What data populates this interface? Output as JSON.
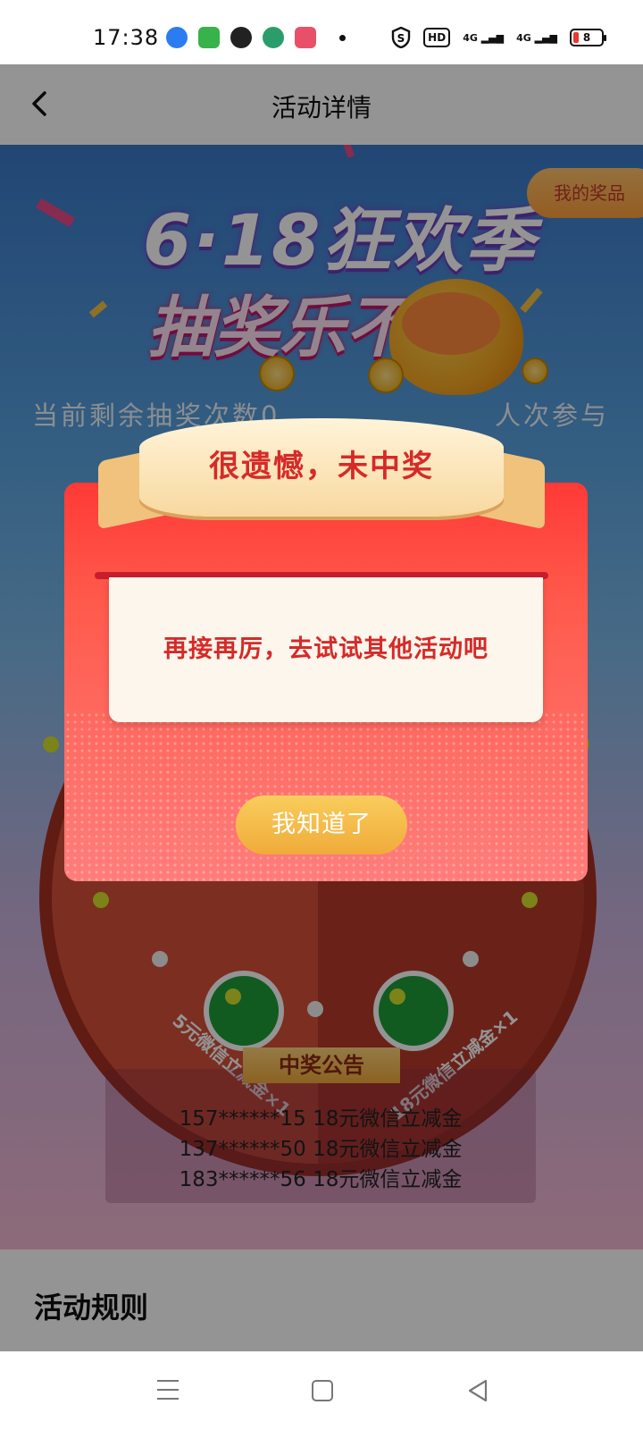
{
  "status_bar": {
    "time": "17:38",
    "hd_badge": "HD",
    "signal_1": "4G",
    "signal_2": "4G",
    "battery": "8",
    "app_icons": [
      "browser-icon",
      "calendar-app-icon",
      "wechat-icon",
      "bank-icon",
      "game-icon"
    ]
  },
  "header": {
    "title": "活动详情",
    "back_icon": "chevron-left-icon"
  },
  "banner": {
    "headline_line1": "6·18狂欢季",
    "headline_line2": "抽奖乐不停",
    "my_prizes": "我的奖品",
    "remaining_draws": "当前剩余抽奖次数0",
    "participants": "人次参与"
  },
  "wheel": {
    "segments": [
      "5元微信立减金×1",
      "18元微信立减金×1"
    ]
  },
  "announcement": {
    "title": "中奖公告",
    "winners": [
      "157******15 18元微信立减金",
      "137******50 18元微信立减金",
      "183******56 18元微信立减金"
    ]
  },
  "rules": {
    "title": "活动规则"
  },
  "dialog": {
    "title": "很遗憾，未中奖",
    "message": "再接再厉，去试试其他活动吧",
    "button": "我知道了"
  },
  "colors": {
    "dialog_red": "#ff3a36",
    "accent_orange": "#f0ab3a",
    "text_red": "#d62a28"
  }
}
